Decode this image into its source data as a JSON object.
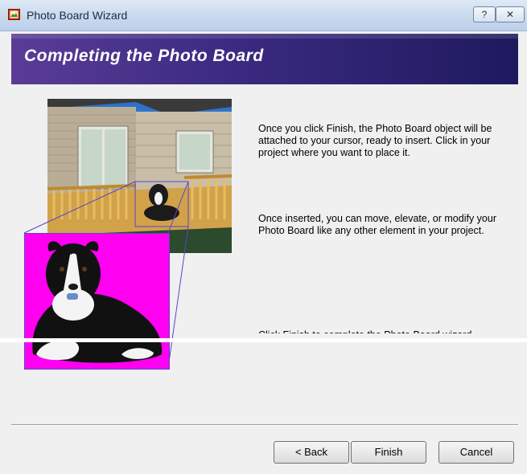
{
  "window": {
    "title": "Photo Board Wizard",
    "help_glyph": "?",
    "close_glyph": "✕"
  },
  "banner": {
    "heading": "Completing the Photo Board"
  },
  "content": {
    "paragraphs": [
      "Once you click Finish, the Photo Board object will be attached to your cursor, ready to insert. Click in your project where you want to place it.",
      "Once inserted, you can move, elevate, or modify your Photo Board like any other element in your project.",
      "Click Finish to complete the Photo Board wizard."
    ]
  },
  "buttons": {
    "back": "< Back",
    "finish": "Finish",
    "cancel": "Cancel"
  },
  "colors": {
    "banner_start": "#5a3c96",
    "banner_end": "#1e1a5e",
    "photo_background": "#ff00f0",
    "selection_outline": "#5a44c8"
  },
  "icons": {
    "app": "photo-board-icon",
    "help": "help-icon",
    "close": "close-icon"
  }
}
